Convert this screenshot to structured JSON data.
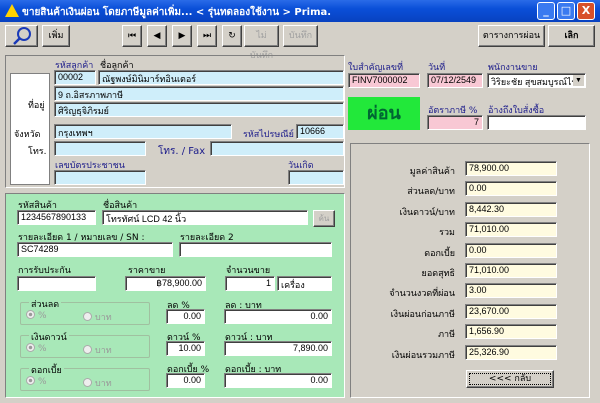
{
  "window": {
    "title": "ขายสินค้าเงินผ่อน โดยภาษีมูลค่าเพิ่ม... < รุ่นทดลองใช้งาน > Prima.",
    "min": "_",
    "max": "□",
    "close": "X"
  },
  "toolbar": {
    "add": "เพิ่ม",
    "first": "⏮",
    "prev": "◀",
    "next": "▶",
    "last": "⏭",
    "refresh": "↻",
    "cancel": "ไม่บันทึก",
    "save": "บันทึก",
    "schedule": "ตารางการผ่อน",
    "quit": "เลิก"
  },
  "customer": {
    "code_label": "รหัสลูกค้า",
    "name_label": "ชื่อลูกค้า",
    "code": "00002",
    "name": "ณัฐพงษ์มินิมาร์ทอินเตอร์",
    "address_label": "ที่อยู่",
    "address1": "9 ถ.อิสรภาพภาษี",
    "address2": "ศิริญธุจิภิรมย์",
    "province_label": "จังหวัด",
    "province": "กรุงเทพฯ",
    "postal_label": "รหัสไปรษณีย์",
    "postal": "10666",
    "phone_label": "โทร.",
    "phone": "",
    "fax_label": "โทร. / Fax",
    "fax": "",
    "id_label": "เลขบัตรประชาชน",
    "id": "",
    "birth_label": "วันเกิด",
    "birth": ""
  },
  "doc": {
    "no_label": "ใบสำคัญเลขที่",
    "no": "FINV7000002",
    "date_label": "วันที่",
    "date": "07/12/2549",
    "sales_label": "พนักงานขาย",
    "sales": "วิริยะชัย สุขสมบูรณ์ไร",
    "badge": "ผ่อน",
    "tax_label": "อัตราภาษี %",
    "tax": "7",
    "ref_label": "อ้างถึงใบสั่งซื้อ",
    "ref": ""
  },
  "product": {
    "code_label": "รหัสสินค้า",
    "code": "1234567890133",
    "name_label": "ชื่อสินค้า",
    "name": "โทรทัศน์ LCD 42 นิ้ว",
    "search": "ค้น",
    "detail1_label": "รายละเอียด 1 / หมายเลข / SN :",
    "detail1": "SC74289",
    "detail2_label": "รายละเอียด 2",
    "detail2": "",
    "warranty_label": "การรับประกัน",
    "warranty": "",
    "price_label": "ราคาขาย",
    "price": "฿78,900.00",
    "qty_label": "จำนวนขาย",
    "qty": "1",
    "unit": "เครื่อง"
  },
  "adjust": [
    {
      "group": "ส่วนลด",
      "opt1": "%",
      "opt2": "บาท",
      "pct_label": "ลด %",
      "pct": "0.00",
      "amt_label": "ลด : บาท",
      "amt": "0.00"
    },
    {
      "group": "เงินดาวน์",
      "opt1": "%",
      "opt2": "บาท",
      "pct_label": "ดาวน์ %",
      "pct": "10.00",
      "amt_label": "ดาวน์ : บาท",
      "amt": "7,890.00"
    },
    {
      "group": "ดอกเบี้ย",
      "opt1": "%",
      "opt2": "บาท",
      "pct_label": "ดอกเบี้ย %",
      "pct": "0.00",
      "amt_label": "ดอกเบี้ย : บาท",
      "amt": "0.00"
    }
  ],
  "summary": [
    {
      "label": "มูลค่าสินค้า",
      "value": "78,900.00"
    },
    {
      "label": "ส่วนลด/บาท",
      "value": "0.00"
    },
    {
      "label": "เงินดาวน์/บาท",
      "value": "8,442.30"
    },
    {
      "label": "รวม",
      "value": "71,010.00"
    },
    {
      "label": "ดอกเบี้ย",
      "value": "0.00"
    },
    {
      "label": "ยอดสุทธิ",
      "value": "71,010.00"
    },
    {
      "label": "จำนวนงวดที่ผ่อน",
      "value": "3.00"
    },
    {
      "label": "เงินผ่อนก่อนภาษี",
      "value": "23,670.00"
    },
    {
      "label": "ภาษี",
      "value": "1,656.90"
    },
    {
      "label": "เงินผ่อนรวมภาษี",
      "value": "25,326.90"
    }
  ],
  "back": "<<<    กลับ"
}
